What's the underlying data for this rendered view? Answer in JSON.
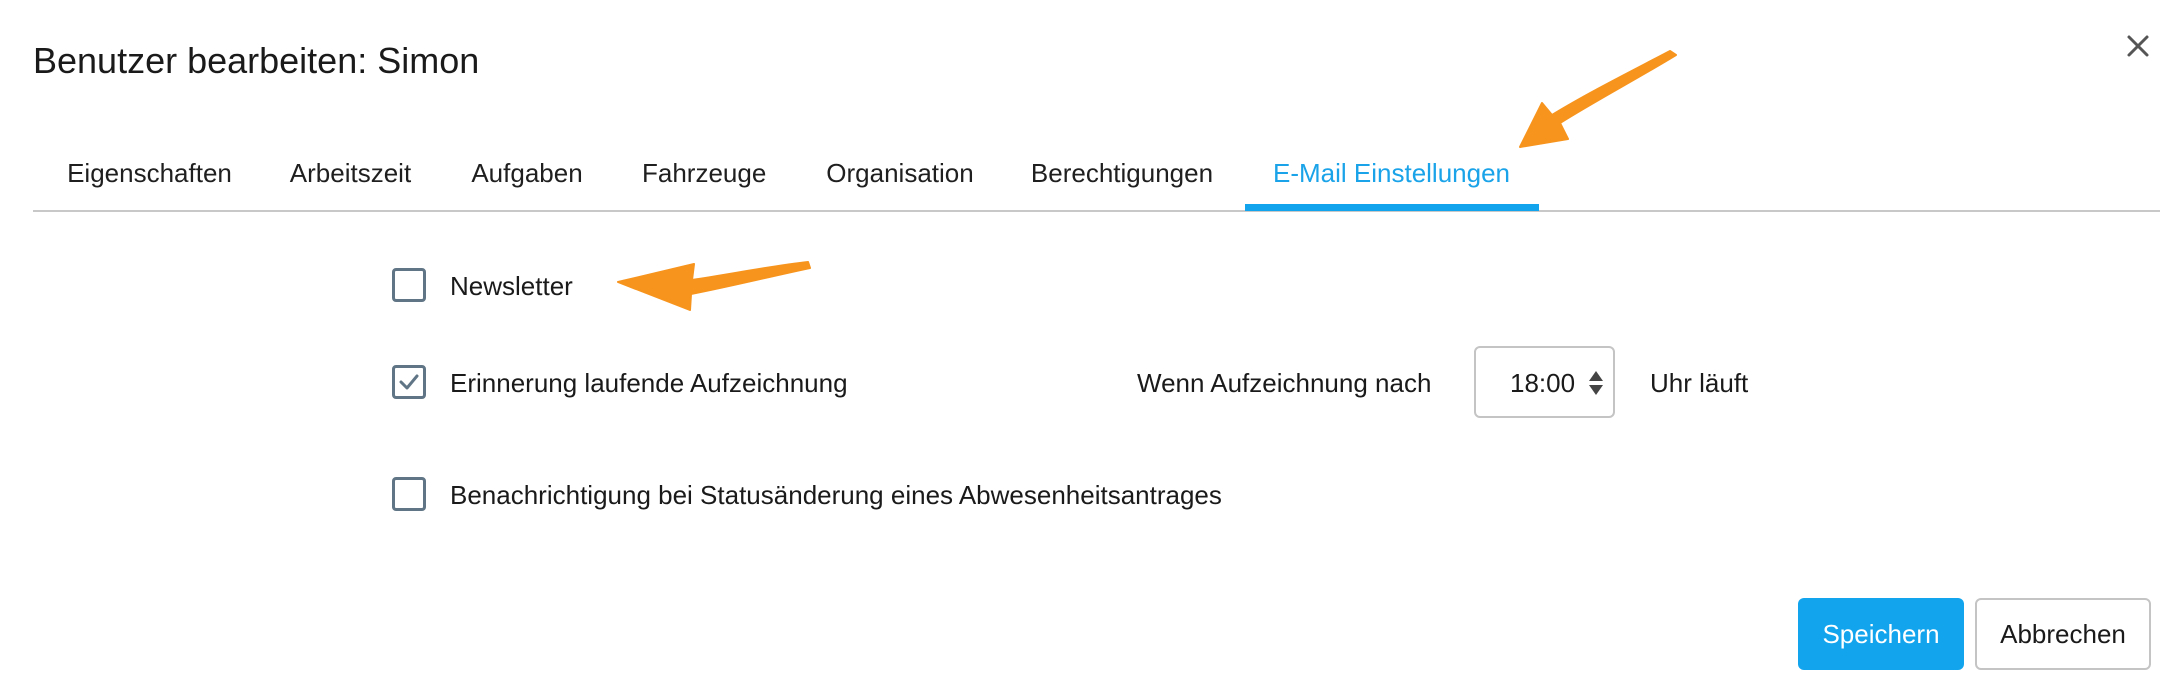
{
  "dialog": {
    "title": "Benutzer bearbeiten: Simon",
    "close_icon": "close-icon"
  },
  "tabs": [
    {
      "label": "Eigenschaften",
      "active": false
    },
    {
      "label": "Arbeitszeit",
      "active": false
    },
    {
      "label": "Aufgaben",
      "active": false
    },
    {
      "label": "Fahrzeuge",
      "active": false
    },
    {
      "label": "Organisation",
      "active": false
    },
    {
      "label": "Berechtigungen",
      "active": false
    },
    {
      "label": "E-Mail Einstellungen",
      "active": true
    }
  ],
  "settings": {
    "newsletter": {
      "label": "Newsletter",
      "checked": false
    },
    "reminder": {
      "label": "Erinnerung laufende Aufzeichnung",
      "checked": true,
      "prefix": "Wenn Aufzeichnung nach",
      "time": "18:00",
      "suffix": "Uhr läuft"
    },
    "absence_notification": {
      "label": "Benachrichtigung bei Statusänderung eines Abwesenheitsantrages",
      "checked": false
    }
  },
  "footer": {
    "save_label": "Speichern",
    "cancel_label": "Abbrechen"
  },
  "annotations": {
    "arrow_color": "#f7941d"
  },
  "colors": {
    "accent": "#12a5ee",
    "active_tab_text": "#1aa3e8",
    "checkbox_border": "#607585"
  }
}
